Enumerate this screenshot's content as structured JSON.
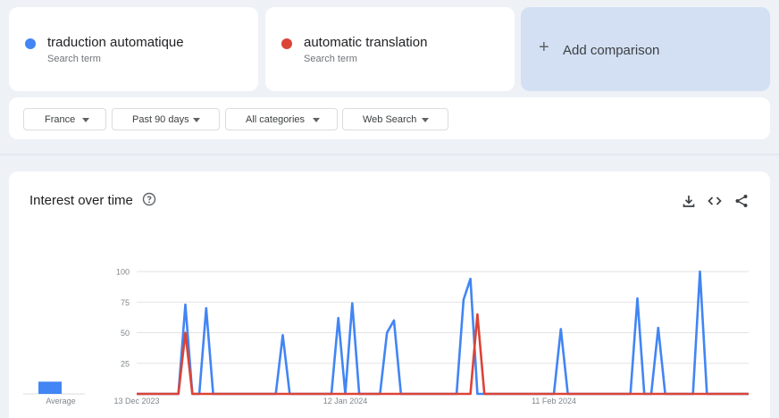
{
  "terms": [
    {
      "label": "traduction automatique",
      "sub": "Search term",
      "color": "#4285f4"
    },
    {
      "label": "automatic translation",
      "sub": "Search term",
      "color": "#db4437"
    }
  ],
  "add_comparison": {
    "label": "Add comparison",
    "icon": "plus-icon"
  },
  "filters": [
    {
      "label": "France"
    },
    {
      "label": "Past 90 days"
    },
    {
      "label": "All categories"
    },
    {
      "label": "Web Search"
    }
  ],
  "chart": {
    "title": "Interest over time",
    "help_icon": "help-circle-icon",
    "tools": [
      "download-icon",
      "embed-code-icon",
      "share-icon"
    ]
  },
  "chart_data": {
    "type": "line",
    "title": "Interest over time",
    "ylim": [
      0,
      100
    ],
    "yticks": [
      25,
      50,
      75,
      100
    ],
    "x_tick_labels": [
      {
        "label": "13 Dec 2023",
        "x": 0
      },
      {
        "label": "12 Jan 2024",
        "x": 30
      },
      {
        "label": "11 Feb 2024",
        "x": 60
      }
    ],
    "grid": true,
    "average": {
      "label": "Average",
      "values": [
        10,
        0
      ]
    },
    "series": [
      {
        "color": "#4285f4",
        "points": [
          [
            0,
            0
          ],
          [
            6,
            0
          ],
          [
            7,
            73
          ],
          [
            8,
            0
          ],
          [
            9,
            0
          ],
          [
            10,
            70
          ],
          [
            11,
            0
          ],
          [
            20,
            0
          ],
          [
            21,
            48
          ],
          [
            22,
            0
          ],
          [
            28,
            0
          ],
          [
            29,
            62
          ],
          [
            30,
            0
          ],
          [
            31,
            74
          ],
          [
            32,
            0
          ],
          [
            35,
            0
          ],
          [
            36,
            50
          ],
          [
            37,
            60
          ],
          [
            38,
            0
          ],
          [
            46,
            0
          ],
          [
            47,
            77
          ],
          [
            48,
            94
          ],
          [
            49,
            0
          ],
          [
            60,
            0
          ],
          [
            61,
            53
          ],
          [
            62,
            0
          ],
          [
            71,
            0
          ],
          [
            72,
            78
          ],
          [
            73,
            0
          ],
          [
            74,
            0
          ],
          [
            75,
            54
          ],
          [
            76,
            0
          ],
          [
            80,
            0
          ],
          [
            81,
            100
          ],
          [
            82,
            0
          ],
          [
            88,
            0
          ]
        ]
      },
      {
        "color": "#db4437",
        "points": [
          [
            0,
            0
          ],
          [
            6,
            0
          ],
          [
            7,
            50
          ],
          [
            8,
            0
          ],
          [
            47,
            0
          ],
          [
            48,
            0
          ],
          [
            49,
            65
          ],
          [
            50,
            0
          ],
          [
            88,
            0
          ]
        ]
      }
    ]
  }
}
